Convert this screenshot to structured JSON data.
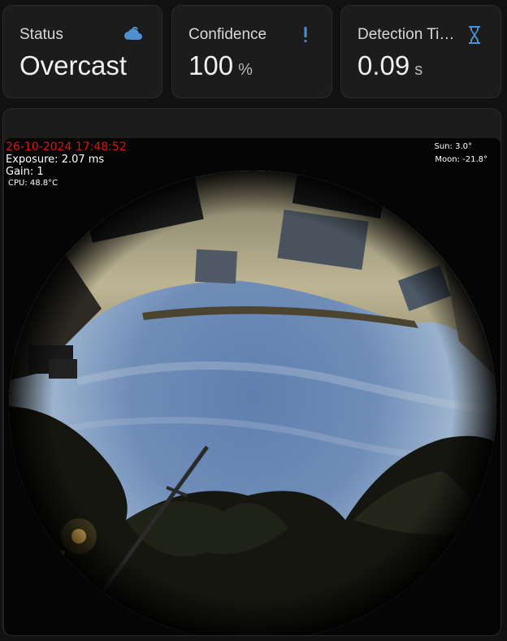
{
  "cards": [
    {
      "name": "Status",
      "value": "Overcast",
      "unit": "",
      "icon": "cloud-icon",
      "icon_color": "#4f8fd0"
    },
    {
      "name": "Confidence",
      "value": "100",
      "unit": "%",
      "icon": "exclamation-icon",
      "icon_color": "#4f8fd0"
    },
    {
      "name": "Detection Time",
      "value": "0.09",
      "unit": "s",
      "icon": "hourglass-icon",
      "icon_color": "#4f8fd0"
    }
  ],
  "camera": {
    "timestamp": "26-10-2024 17:48:52",
    "exposure": "Exposure: 2.07 ms",
    "gain": "Gain: 1",
    "cpu": "CPU: 48.8°C",
    "sun": "Sun: 3.0°",
    "moon": "Moon: -21.8°",
    "timestamp_color": "#e01010"
  },
  "colors": {
    "background": "#111111",
    "card": "#1c1c1c",
    "accent": "#4f8fd0"
  }
}
